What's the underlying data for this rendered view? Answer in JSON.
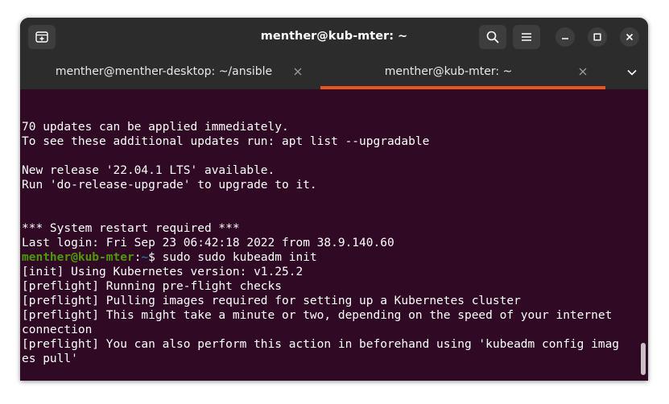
{
  "window": {
    "title": "menther@kub-mter: ~"
  },
  "tabs": [
    {
      "label": "menther@menther-desktop: ~/ansible",
      "active": false
    },
    {
      "label": "menther@kub-mter: ~",
      "active": true
    }
  ],
  "terminal": {
    "lines": {
      "l1": "70 updates can be applied immediately.",
      "l2": "To see these additional updates run: apt list --upgradable",
      "l3": "New release '22.04.1 LTS' available.",
      "l4": "Run 'do-release-upgrade' to upgrade to it.",
      "l5": "*** System restart required ***",
      "l6": "Last login: Fri Sep 23 06:42:18 2022 from 38.9.140.60",
      "l8": "[init] Using Kubernetes version: v1.25.2",
      "l9": "[preflight] Running pre-flight checks",
      "l10": "[preflight] Pulling images required for setting up a Kubernetes cluster",
      "l11": "[preflight] This might take a minute or two, depending on the speed of your internet",
      "l12": "connection",
      "l13": "[preflight] You can also perform this action in beforehand using 'kubeadm config imag",
      "l14": "es pull'"
    },
    "prompt": {
      "user_host": "menther@kub-mter",
      "sep": ":",
      "path": "~",
      "symbol": "$",
      "command": " sudo sudo kubeadm init"
    }
  },
  "colors": {
    "terminal_bg": "#300a24",
    "accent": "#e95420",
    "prompt_user": "#4e9a06",
    "prompt_path": "#3465a4"
  },
  "icons": {
    "new_tab": "new-tab-icon",
    "search": "search-icon",
    "menu": "hamburger-menu-icon",
    "minimize": "minimize-icon",
    "maximize": "maximize-icon",
    "close": "close-icon",
    "tab_close": "close-icon",
    "tab_dropdown": "chevron-down-icon"
  }
}
